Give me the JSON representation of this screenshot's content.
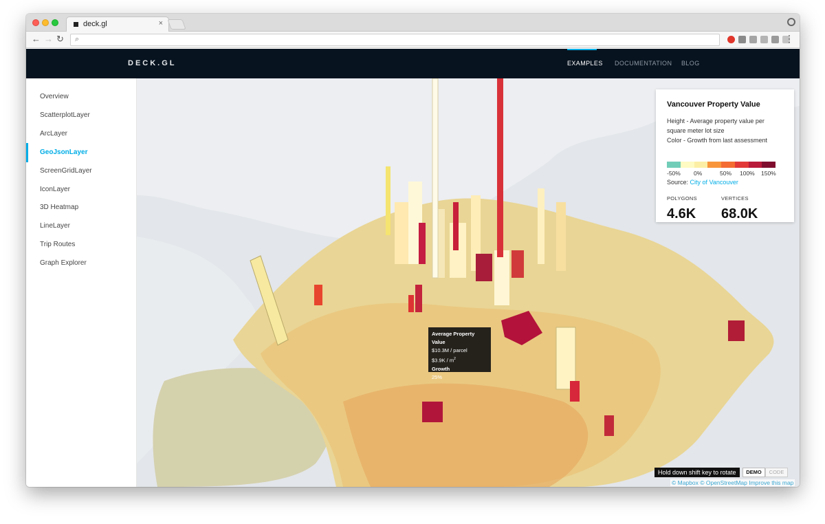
{
  "browser": {
    "tab_title": "deck.gl",
    "tab_close": "×",
    "address": ""
  },
  "site": {
    "logo": "DECK.GL",
    "nav": [
      {
        "label": "EXAMPLES",
        "active": true
      },
      {
        "label": "DOCUMENTATION",
        "active": false
      },
      {
        "label": "BLOG",
        "active": false
      }
    ]
  },
  "sidebar": {
    "items": [
      {
        "label": "Overview",
        "active": false
      },
      {
        "label": "ScatterplotLayer",
        "active": false
      },
      {
        "label": "ArcLayer",
        "active": false
      },
      {
        "label": "GeoJsonLayer",
        "active": true
      },
      {
        "label": "ScreenGridLayer",
        "active": false
      },
      {
        "label": "IconLayer",
        "active": false
      },
      {
        "label": "3D Heatmap",
        "active": false
      },
      {
        "label": "LineLayer",
        "active": false
      },
      {
        "label": "Trip Routes",
        "active": false
      },
      {
        "label": "Graph Explorer",
        "active": false
      }
    ]
  },
  "legend": {
    "title": "Vancouver Property Value",
    "desc_line1": "Height - Average property value per",
    "desc_line2": "square meter lot size",
    "desc_line3": "Color - Growth from last assessment",
    "colors": [
      "#72cdb8",
      "#fffbc2",
      "#fcefa5",
      "#f8953b",
      "#f46c31",
      "#e23838",
      "#b81a3a",
      "#7f0e2e"
    ],
    "ticks": [
      "-50%",
      "0%",
      "50%",
      "100%",
      "150%"
    ],
    "source_prefix": "Source: ",
    "source_link": "City of Vancouver",
    "stats": [
      {
        "label": "POLYGONS",
        "value": "4.6K"
      },
      {
        "label": "VERTICES",
        "value": "68.0K"
      }
    ]
  },
  "tooltip": {
    "heading1": "Average Property Value",
    "line1": "$10.3M / parcel",
    "line2_main": "$3.9K / m",
    "line2_sup": "2",
    "heading2": "Growth",
    "line3": "25%"
  },
  "controls": {
    "hint": "Hold down shift key to rotate",
    "demo": "DEMO",
    "code": "CODE"
  },
  "attribution": "© Mapbox © OpenStreetMap Improve this map"
}
